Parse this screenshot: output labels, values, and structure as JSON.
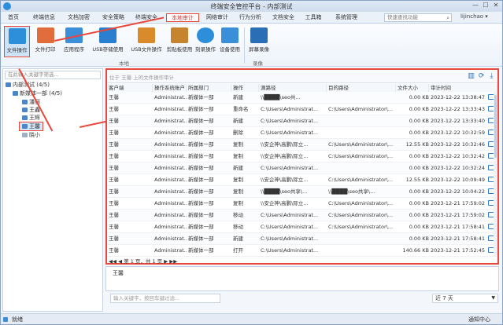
{
  "window": {
    "title": "终端安全管控平台 - 内部测试",
    "minimize": "—",
    "maximize": "☐",
    "close": "✕"
  },
  "menu": {
    "items": [
      "首页",
      "终端信息",
      "文档加密",
      "安全策略",
      "终端安全",
      "本地审计",
      "网络审计",
      "行为分析",
      "文档安全",
      "工具箱",
      "系统管理"
    ],
    "active_index": 5,
    "search_placeholder": "快速查找功能",
    "user": "lijinchao"
  },
  "toolbar": {
    "buttons": [
      "文件操作",
      "文件打印",
      "应用程序",
      "USB存储使用",
      "USB文件操作",
      "剪贴板使用",
      "刻录操作",
      "设备使用",
      "屏幕录像"
    ],
    "active_index": 0,
    "group_local": "本地",
    "group_record": "录像"
  },
  "sidebar": {
    "search_placeholder": "在此输入关键字筛选...",
    "tree": [
      {
        "label": "内部测试 (4/5)",
        "level": 0
      },
      {
        "label": "新媒体一部 (4/5)",
        "level": 1
      },
      {
        "label": "潘丽",
        "level": 2
      },
      {
        "label": "王鑫",
        "level": 2
      },
      {
        "label": "王辉",
        "level": 2
      },
      {
        "label": "王馨",
        "level": 2,
        "selected": true
      },
      {
        "label": "晓小",
        "level": 2
      }
    ]
  },
  "main": {
    "filter_hint": "位于 王馨 上的文件操作审计",
    "columns": [
      "客户端",
      "操作系统账户",
      "所属部门",
      "操作",
      "源路径",
      "目的路径",
      "文件大小",
      "审计时间"
    ],
    "rows": [
      [
        "王馨",
        "Administrat...",
        "新媒体一部",
        "新建",
        "\\\\████\\seo共...",
        "",
        "0.00 KB",
        "2023-12-22 13:38:47"
      ],
      [
        "王馨",
        "Administrat...",
        "新媒体一部",
        "重命名",
        "C:\\Users\\Administrat...",
        "C:\\Users\\Administrator\\...",
        "0.00 KB",
        "2023-12-22 13:33:43"
      ],
      [
        "王馨",
        "Administrat...",
        "新媒体一部",
        "新建",
        "C:\\Users\\Administrat...",
        "",
        "0.00 KB",
        "2023-12-22 13:33:40"
      ],
      [
        "王馨",
        "Administrat...",
        "新媒体一部",
        "删除",
        "C:\\Users\\Administrat...",
        "",
        "0.00 KB",
        "2023-12-22 10:32:59"
      ],
      [
        "王馨",
        "Administrat...",
        "新媒体一部",
        "复制",
        "\\\\安企神\\高鹏\\际立...",
        "C:\\Users\\Administrator\\...",
        "12.55 KB",
        "2023-12-22 10:32:46"
      ],
      [
        "王馨",
        "Administrat...",
        "新媒体一部",
        "复制",
        "\\\\安企神\\高鹏\\际立...",
        "C:\\Users\\Administrator\\...",
        "0.00 KB",
        "2023-12-22 10:32:42"
      ],
      [
        "王馨",
        "Administrat...",
        "新媒体一部",
        "新建",
        "C:\\Users\\Administrat...",
        "",
        "0.00 KB",
        "2023-12-22 10:32:24"
      ],
      [
        "王馨",
        "Administrat...",
        "新媒体一部",
        "复制",
        "\\\\安企神\\高鹏\\际立...",
        "C:\\Users\\Administrator\\...",
        "12.55 KB",
        "2023-12-22 10:09:49"
      ],
      [
        "王馨",
        "Administrat...",
        "新媒体一部",
        "复制",
        "\\\\████\\seo共享\\...",
        "\\\\████\\seo共享\\...",
        "0.00 KB",
        "2023-12-22 10:04:22"
      ],
      [
        "王馨",
        "Administrat...",
        "新媒体一部",
        "复制",
        "\\\\安企神\\高鹏\\际立...",
        "C:\\Users\\Administrator\\...",
        "0.00 KB",
        "2023-12-21 17:59:02"
      ],
      [
        "王馨",
        "Administrat...",
        "新媒体一部",
        "移动",
        "C:\\Users\\Administrat...",
        "C:\\Users\\Administrator\\...",
        "0.00 KB",
        "2023-12-21 17:59:02"
      ],
      [
        "王馨",
        "Administrat...",
        "新媒体一部",
        "移动",
        "C:\\Users\\Administrat...",
        "C:\\Users\\Administrator\\...",
        "0.00 KB",
        "2023-12-21 17:58:41"
      ],
      [
        "王馨",
        "Administrat...",
        "新媒体一部",
        "新建",
        "C:\\Users\\Administrat...",
        "",
        "0.00 KB",
        "2023-12-21 17:58:41"
      ],
      [
        "王馨",
        "Administrat...",
        "新媒体一部",
        "打开",
        "C:\\Users\\Administrat...",
        "",
        "140.66 KB",
        "2023-12-21 17:52:45"
      ]
    ],
    "pager": "◀◀  ◀  第 1 页，共 1 页  ▶  ▶▶"
  },
  "detail": {
    "text": "王馨"
  },
  "bottom": {
    "input_placeholder": "输入关键字，按回车键过滤...",
    "period": "近 7 天"
  },
  "status": {
    "left": "就绪",
    "right": "通知中心"
  },
  "colors": {
    "highlight": "#e8473a",
    "accent": "#2d6fb5"
  }
}
